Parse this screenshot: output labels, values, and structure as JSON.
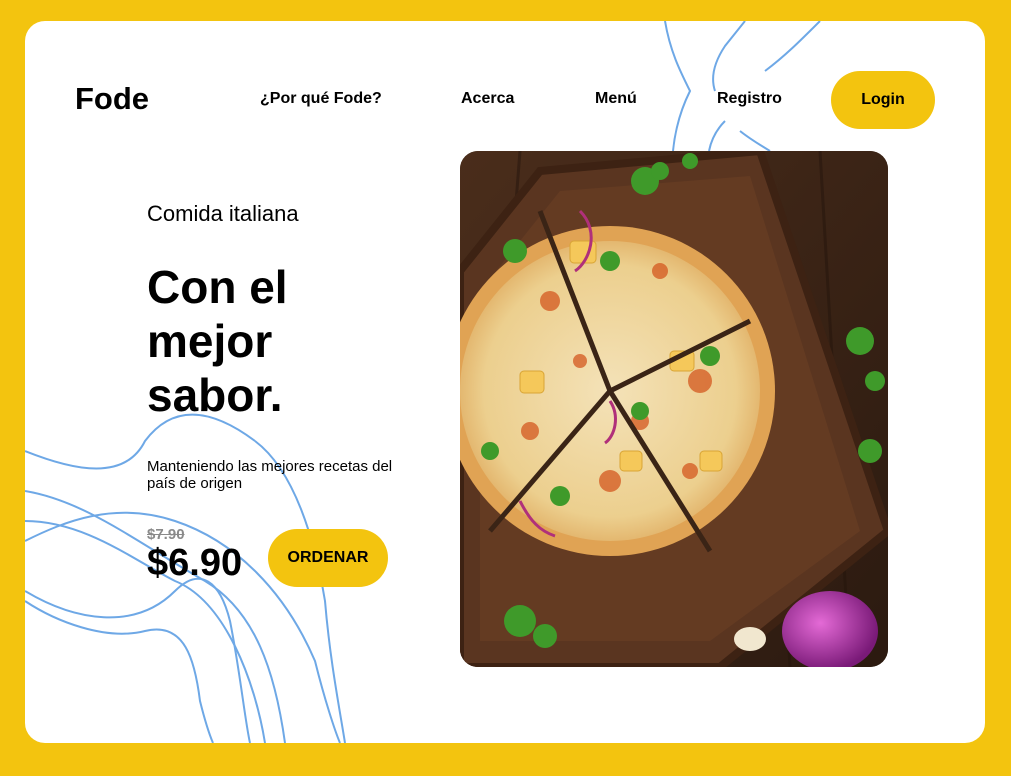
{
  "brand": {
    "name": "Fode"
  },
  "nav": {
    "items": [
      {
        "label": "¿Por qué Fode?"
      },
      {
        "label": "Acerca"
      },
      {
        "label": "Menú"
      },
      {
        "label": "Registro"
      }
    ],
    "login_label": "Login"
  },
  "hero": {
    "eyebrow": "Comida italiana",
    "headline": "Con el mejor sabor.",
    "tagline": "Manteniendo las mejores recetas del país de origen",
    "old_price": "$7.90",
    "price": "$6.90",
    "order_label": "ORDENAR",
    "image": "pizza-photo"
  },
  "colors": {
    "background": "#f3c40f",
    "card": "#ffffff",
    "accent": "#f3c40f",
    "lines": "#6ea8e6"
  }
}
